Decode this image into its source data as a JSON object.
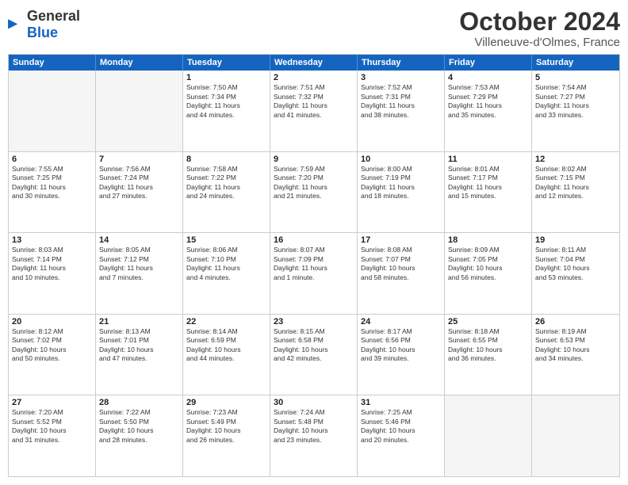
{
  "header": {
    "logo_general": "General",
    "logo_blue": "Blue",
    "month": "October 2024",
    "location": "Villeneuve-d'Olmes, France"
  },
  "weekdays": [
    "Sunday",
    "Monday",
    "Tuesday",
    "Wednesday",
    "Thursday",
    "Friday",
    "Saturday"
  ],
  "rows": [
    [
      {
        "day": "",
        "lines": [],
        "empty": true
      },
      {
        "day": "",
        "lines": [],
        "empty": true
      },
      {
        "day": "1",
        "lines": [
          "Sunrise: 7:50 AM",
          "Sunset: 7:34 PM",
          "Daylight: 11 hours",
          "and 44 minutes."
        ]
      },
      {
        "day": "2",
        "lines": [
          "Sunrise: 7:51 AM",
          "Sunset: 7:32 PM",
          "Daylight: 11 hours",
          "and 41 minutes."
        ]
      },
      {
        "day": "3",
        "lines": [
          "Sunrise: 7:52 AM",
          "Sunset: 7:31 PM",
          "Daylight: 11 hours",
          "and 38 minutes."
        ]
      },
      {
        "day": "4",
        "lines": [
          "Sunrise: 7:53 AM",
          "Sunset: 7:29 PM",
          "Daylight: 11 hours",
          "and 35 minutes."
        ]
      },
      {
        "day": "5",
        "lines": [
          "Sunrise: 7:54 AM",
          "Sunset: 7:27 PM",
          "Daylight: 11 hours",
          "and 33 minutes."
        ]
      }
    ],
    [
      {
        "day": "6",
        "lines": [
          "Sunrise: 7:55 AM",
          "Sunset: 7:25 PM",
          "Daylight: 11 hours",
          "and 30 minutes."
        ]
      },
      {
        "day": "7",
        "lines": [
          "Sunrise: 7:56 AM",
          "Sunset: 7:24 PM",
          "Daylight: 11 hours",
          "and 27 minutes."
        ]
      },
      {
        "day": "8",
        "lines": [
          "Sunrise: 7:58 AM",
          "Sunset: 7:22 PM",
          "Daylight: 11 hours",
          "and 24 minutes."
        ]
      },
      {
        "day": "9",
        "lines": [
          "Sunrise: 7:59 AM",
          "Sunset: 7:20 PM",
          "Daylight: 11 hours",
          "and 21 minutes."
        ]
      },
      {
        "day": "10",
        "lines": [
          "Sunrise: 8:00 AM",
          "Sunset: 7:19 PM",
          "Daylight: 11 hours",
          "and 18 minutes."
        ]
      },
      {
        "day": "11",
        "lines": [
          "Sunrise: 8:01 AM",
          "Sunset: 7:17 PM",
          "Daylight: 11 hours",
          "and 15 minutes."
        ]
      },
      {
        "day": "12",
        "lines": [
          "Sunrise: 8:02 AM",
          "Sunset: 7:15 PM",
          "Daylight: 11 hours",
          "and 12 minutes."
        ]
      }
    ],
    [
      {
        "day": "13",
        "lines": [
          "Sunrise: 8:03 AM",
          "Sunset: 7:14 PM",
          "Daylight: 11 hours",
          "and 10 minutes."
        ]
      },
      {
        "day": "14",
        "lines": [
          "Sunrise: 8:05 AM",
          "Sunset: 7:12 PM",
          "Daylight: 11 hours",
          "and 7 minutes."
        ]
      },
      {
        "day": "15",
        "lines": [
          "Sunrise: 8:06 AM",
          "Sunset: 7:10 PM",
          "Daylight: 11 hours",
          "and 4 minutes."
        ]
      },
      {
        "day": "16",
        "lines": [
          "Sunrise: 8:07 AM",
          "Sunset: 7:09 PM",
          "Daylight: 11 hours",
          "and 1 minute."
        ]
      },
      {
        "day": "17",
        "lines": [
          "Sunrise: 8:08 AM",
          "Sunset: 7:07 PM",
          "Daylight: 10 hours",
          "and 58 minutes."
        ]
      },
      {
        "day": "18",
        "lines": [
          "Sunrise: 8:09 AM",
          "Sunset: 7:05 PM",
          "Daylight: 10 hours",
          "and 56 minutes."
        ]
      },
      {
        "day": "19",
        "lines": [
          "Sunrise: 8:11 AM",
          "Sunset: 7:04 PM",
          "Daylight: 10 hours",
          "and 53 minutes."
        ]
      }
    ],
    [
      {
        "day": "20",
        "lines": [
          "Sunrise: 8:12 AM",
          "Sunset: 7:02 PM",
          "Daylight: 10 hours",
          "and 50 minutes."
        ]
      },
      {
        "day": "21",
        "lines": [
          "Sunrise: 8:13 AM",
          "Sunset: 7:01 PM",
          "Daylight: 10 hours",
          "and 47 minutes."
        ]
      },
      {
        "day": "22",
        "lines": [
          "Sunrise: 8:14 AM",
          "Sunset: 6:59 PM",
          "Daylight: 10 hours",
          "and 44 minutes."
        ]
      },
      {
        "day": "23",
        "lines": [
          "Sunrise: 8:15 AM",
          "Sunset: 6:58 PM",
          "Daylight: 10 hours",
          "and 42 minutes."
        ]
      },
      {
        "day": "24",
        "lines": [
          "Sunrise: 8:17 AM",
          "Sunset: 6:56 PM",
          "Daylight: 10 hours",
          "and 39 minutes."
        ]
      },
      {
        "day": "25",
        "lines": [
          "Sunrise: 8:18 AM",
          "Sunset: 6:55 PM",
          "Daylight: 10 hours",
          "and 36 minutes."
        ]
      },
      {
        "day": "26",
        "lines": [
          "Sunrise: 8:19 AM",
          "Sunset: 6:53 PM",
          "Daylight: 10 hours",
          "and 34 minutes."
        ]
      }
    ],
    [
      {
        "day": "27",
        "lines": [
          "Sunrise: 7:20 AM",
          "Sunset: 5:52 PM",
          "Daylight: 10 hours",
          "and 31 minutes."
        ]
      },
      {
        "day": "28",
        "lines": [
          "Sunrise: 7:22 AM",
          "Sunset: 5:50 PM",
          "Daylight: 10 hours",
          "and 28 minutes."
        ]
      },
      {
        "day": "29",
        "lines": [
          "Sunrise: 7:23 AM",
          "Sunset: 5:49 PM",
          "Daylight: 10 hours",
          "and 26 minutes."
        ]
      },
      {
        "day": "30",
        "lines": [
          "Sunrise: 7:24 AM",
          "Sunset: 5:48 PM",
          "Daylight: 10 hours",
          "and 23 minutes."
        ]
      },
      {
        "day": "31",
        "lines": [
          "Sunrise: 7:25 AM",
          "Sunset: 5:46 PM",
          "Daylight: 10 hours",
          "and 20 minutes."
        ]
      },
      {
        "day": "",
        "lines": [],
        "empty": true
      },
      {
        "day": "",
        "lines": [],
        "empty": true
      }
    ]
  ]
}
